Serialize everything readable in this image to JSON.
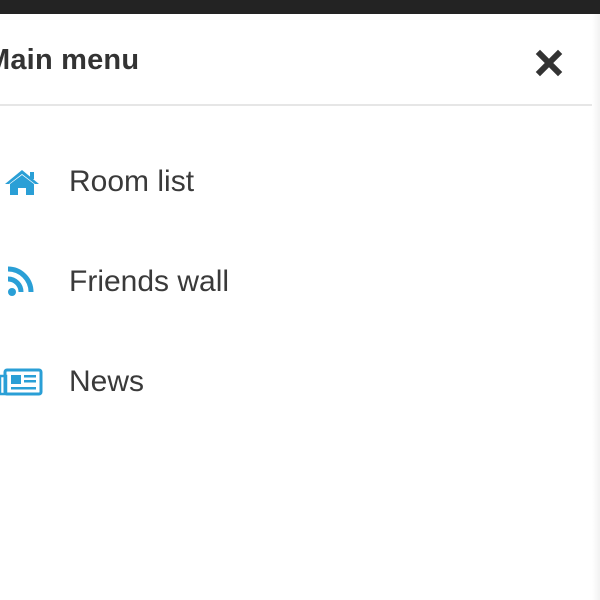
{
  "header": {
    "title": "Main menu",
    "close_icon": "close-icon"
  },
  "menu": {
    "items": [
      {
        "label": "Room list",
        "icon": "home-icon"
      },
      {
        "label": "Friends wall",
        "icon": "rss-feed-icon"
      },
      {
        "label": "News",
        "icon": "newspaper-icon"
      }
    ]
  },
  "colors": {
    "accent": "#2a9fd6",
    "text": "#333333",
    "top_bar": "#232323",
    "divider": "#e6e6e6"
  }
}
